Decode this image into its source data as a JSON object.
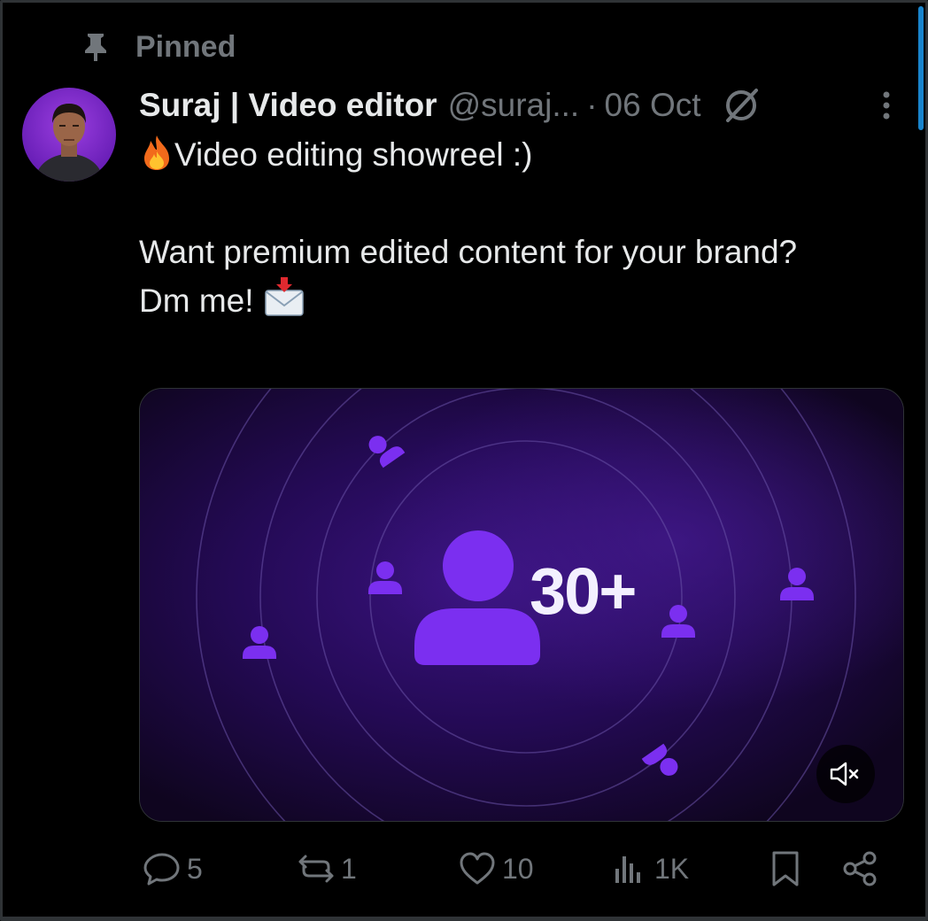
{
  "pinned": {
    "label": "Pinned"
  },
  "post": {
    "display_name": "Suraj | Video editor",
    "handle": "@suraj...",
    "separator": "·",
    "date": "06 Oct",
    "text_line1": "Video editing showreel :)",
    "text_line2": "Want premium edited content for your brand?",
    "text_line3": "Dm me!"
  },
  "media": {
    "overlay_text": "30+",
    "accent_color": "#7b2ff0",
    "mute_icon": "speaker-muted-icon"
  },
  "actions": {
    "replies": "5",
    "reposts": "1",
    "likes": "10",
    "views": "1K"
  },
  "colors": {
    "text_primary": "#e7e9ea",
    "text_secondary": "#71767b",
    "accent": "#1d9bf0",
    "divider": "#2f3336"
  }
}
